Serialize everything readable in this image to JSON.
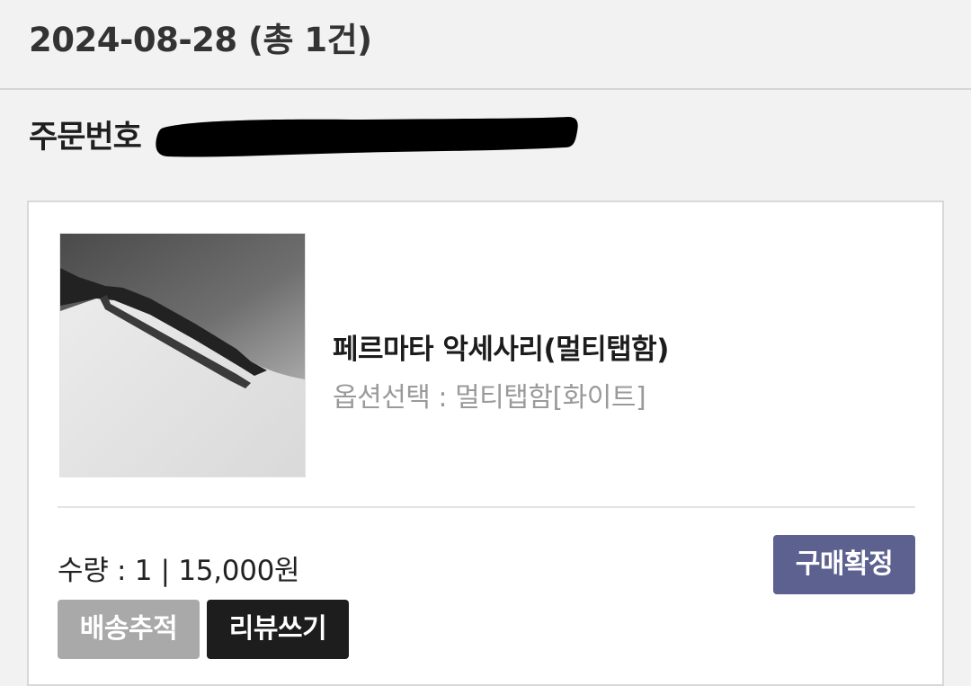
{
  "date_header": {
    "text": "2024-08-28 (총 1건)"
  },
  "order": {
    "label": "주문번호"
  },
  "product": {
    "name": "페르마타 악세사리(멀티탭함)",
    "option": "옵션선택 : 멀티탭함[화이트]",
    "quantity_price": "수량 : 1 | 15,000원"
  },
  "buttons": {
    "confirm": "구매확정",
    "track": "배송추적",
    "review": "리뷰쓰기"
  },
  "colors": {
    "confirm_bg": "#5d6190",
    "track_bg": "#a9a9a9",
    "review_bg": "#1d1d1d",
    "page_bg": "#f1f2f1"
  }
}
